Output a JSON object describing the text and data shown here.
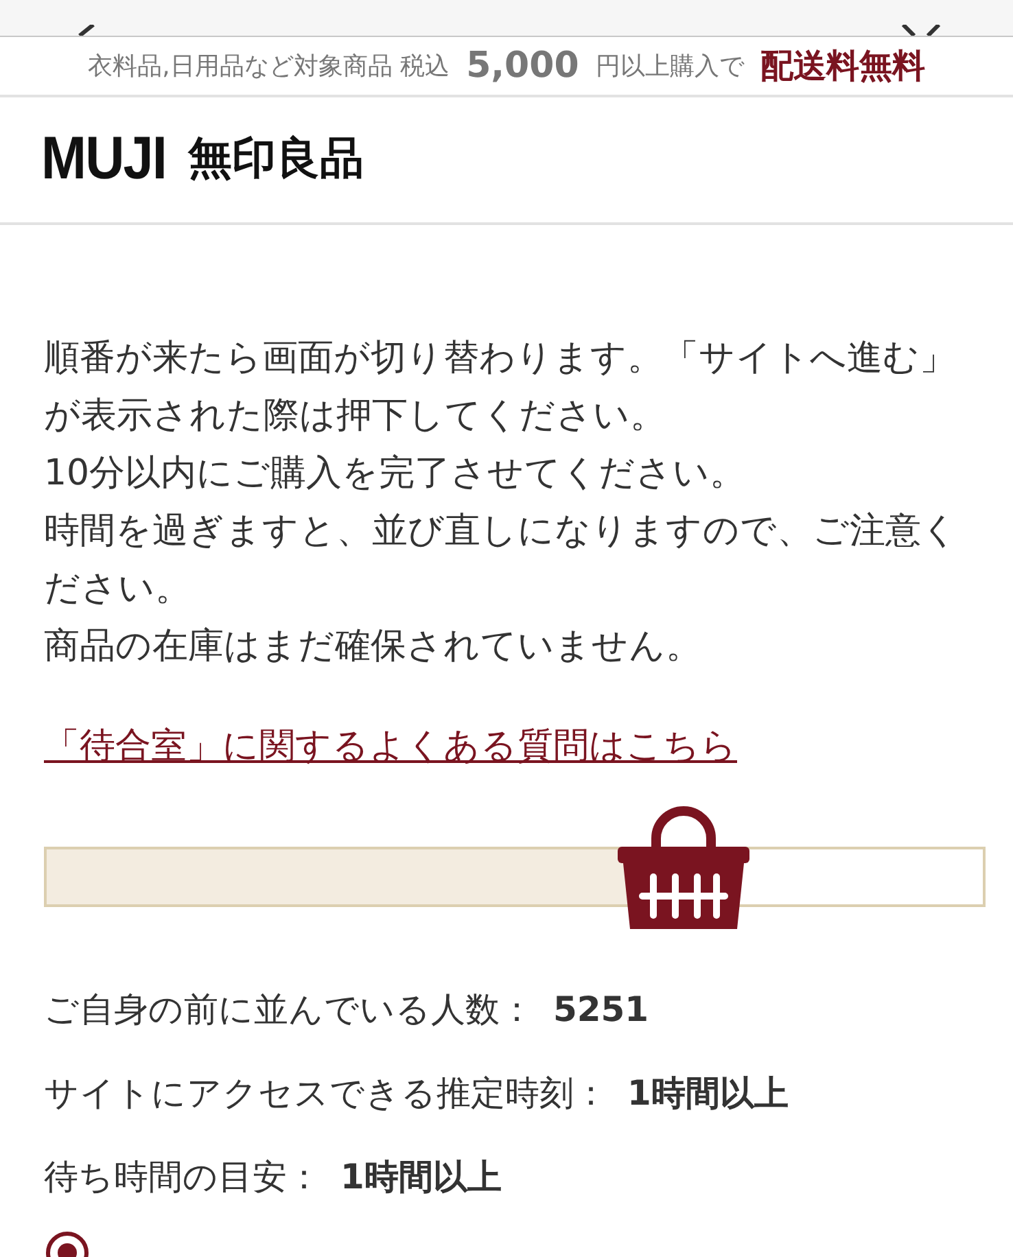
{
  "banner": {
    "prefix": "衣料品,日用品など対象商品 税込",
    "amount": "5,000",
    "middle": "円以上購入で",
    "highlight": "配送料無料"
  },
  "logo": {
    "brand": "MUJI",
    "name": "無印良品"
  },
  "notice": [
    "順番が来たら画面が切り替わります。「サイトへ進む」が表示された際は押下してください。",
    "10分以内にご購入を完了させてください。",
    "時間を過ぎますと、並び直しになりますので、ご注意ください。",
    "商品の在庫はまだ確保されていません。"
  ],
  "faq_link": "「待合室」に関するよくある質問はこちら",
  "progress": {
    "level": 0.68
  },
  "stats": [
    {
      "label": "ご自身の前に並んでいる人数：",
      "value": "5251"
    },
    {
      "label": "サイトにアクセスできる推定時刻：",
      "value": "1時間以上"
    },
    {
      "label": "待ち時間の目安：",
      "value": "1時間以上"
    }
  ]
}
